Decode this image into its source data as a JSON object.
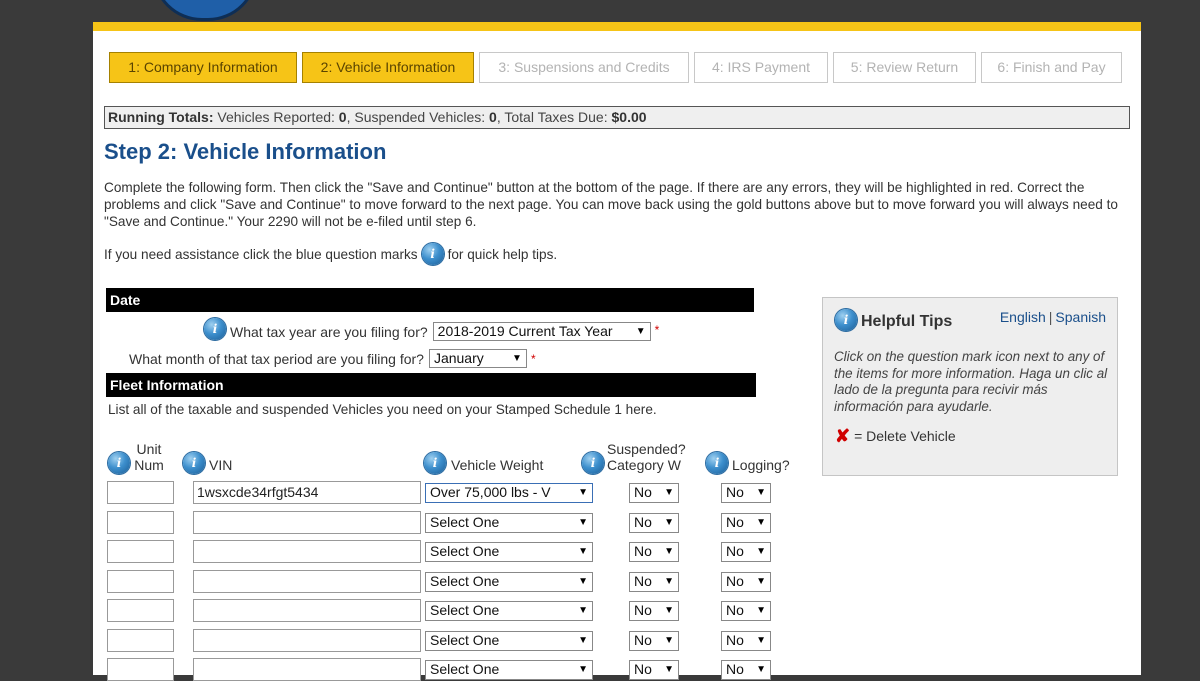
{
  "steps": [
    {
      "label": "1: Company Information",
      "state": "active"
    },
    {
      "label": "2: Vehicle Information",
      "state": "active"
    },
    {
      "label": "3: Suspensions and Credits",
      "state": "inactive"
    },
    {
      "label": "4: IRS Payment",
      "state": "inactive"
    },
    {
      "label": "5: Review Return",
      "state": "inactive"
    },
    {
      "label": "6: Finish and Pay",
      "state": "inactive"
    }
  ],
  "totals": {
    "prefix": "Running Totals:",
    "vehicles_label": " Vehicles Reported: ",
    "vehicles_value": "0",
    "suspended_label": ", Suspended Vehicles: ",
    "suspended_value": "0",
    "taxes_label": ", Total Taxes Due: ",
    "taxes_value": "$0.00"
  },
  "title": "Step 2: Vehicle Information",
  "intro": "Complete the following form. Then click the \"Save and Continue\" button at the bottom of the page. If there are any errors, they will be highlighted in red. Correct the problems and click \"Save and Continue\" to move forward to the next page. You can move back using the gold buttons above but to move forward you will always need to \"Save and Continue.\" Your 2290 will not be e-filed until step 6.",
  "assist": {
    "before": "If you need assistance click the blue question marks",
    "after": "for quick help tips."
  },
  "help_icon_glyph": "i",
  "date_section": {
    "heading": "Date",
    "tax_year_label": "What tax year are you filing for?",
    "tax_year_value": "2018-2019 Current Tax Year",
    "month_label": "What month of that tax period are you filing for?",
    "month_value": "January",
    "required_mark": "*"
  },
  "fleet_section": {
    "heading": "Fleet Information",
    "note": "List all of the taxable and suspended Vehicles you need on your Stamped Schedule 1 here.",
    "col_unit": "Unit\nNum",
    "col_vin": "VIN",
    "col_weight": "Vehicle Weight",
    "col_suspended": "Suspended?\nCategory W",
    "col_logging": "Logging?",
    "rows": [
      {
        "unit": "",
        "vin": "1wsxcde34rfgt5434",
        "weight": "Over 75,000 lbs - V",
        "suspended": "No",
        "logging": "No"
      },
      {
        "unit": "",
        "vin": "",
        "weight": "Select One",
        "suspended": "No",
        "logging": "No"
      },
      {
        "unit": "",
        "vin": "",
        "weight": "Select One",
        "suspended": "No",
        "logging": "No"
      },
      {
        "unit": "",
        "vin": "",
        "weight": "Select One",
        "suspended": "No",
        "logging": "No"
      },
      {
        "unit": "",
        "vin": "",
        "weight": "Select One",
        "suspended": "No",
        "logging": "No"
      },
      {
        "unit": "",
        "vin": "",
        "weight": "Select One",
        "suspended": "No",
        "logging": "No"
      },
      {
        "unit": "",
        "vin": "",
        "weight": "Select One",
        "suspended": "No",
        "logging": "No"
      }
    ]
  },
  "tips": {
    "title": "Helpful Tips",
    "english": "English",
    "separator": "|",
    "spanish": "Spanish",
    "body": "Click on the question mark icon next to any of the items for more information. Haga un clic al lado de la pregunta para recivir más información para ayudarle.",
    "delete_icon": "✘",
    "delete_label": "= Delete Vehicle"
  },
  "dropdown_arrow": "▼",
  "colors": {
    "gold": "#f6c417",
    "title_blue": "#1a4f8b",
    "required_red": "#d00000"
  }
}
